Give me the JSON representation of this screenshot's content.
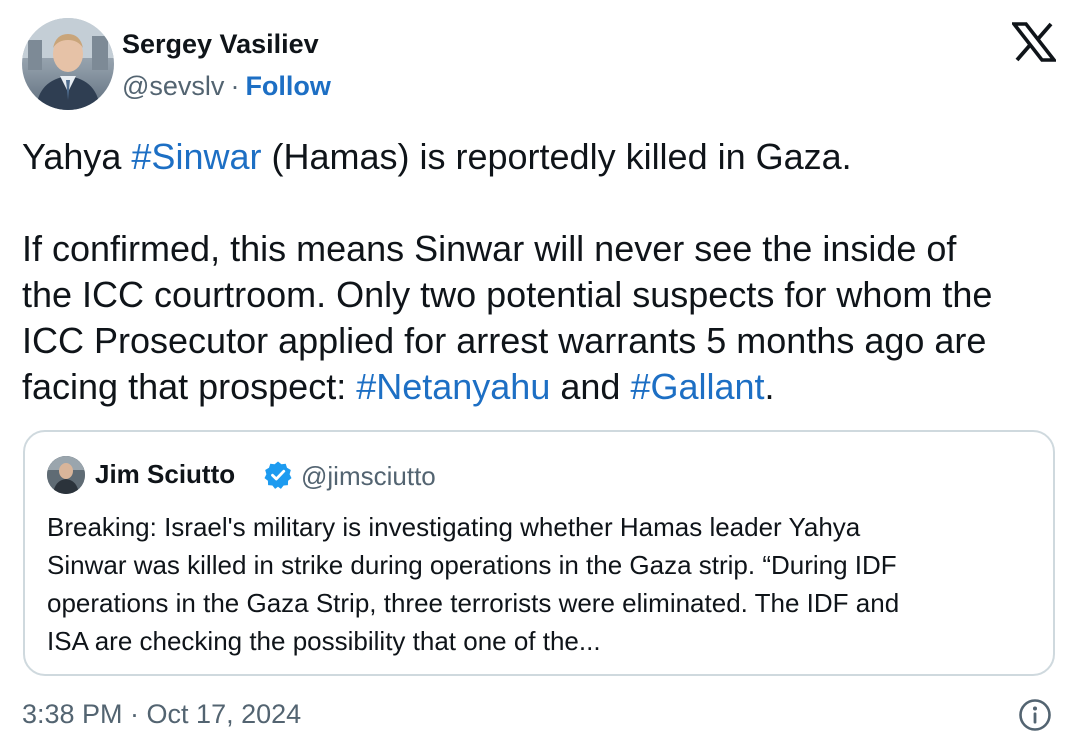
{
  "author": {
    "name": "Sergey Vasiliev",
    "handle": "@sevslv",
    "separator": "·",
    "follow_label": "Follow"
  },
  "tweet": {
    "line1": {
      "before": "Yahya ",
      "hashtag": "#Sinwar",
      "after": " (Hamas) is reportedly killed in Gaza."
    },
    "line2": "If confirmed, this means Sinwar will never see the inside of",
    "line3": "the ICC courtroom. Only two potential suspects for whom the",
    "line4": "ICC Prosecutor applied for arrest warrants 5 months ago are",
    "line5": {
      "before": "facing that prospect: ",
      "hashtag1": "#Netanyahu",
      "middle": " and ",
      "hashtag2": "#Gallant",
      "after": "."
    }
  },
  "quote": {
    "name": "Jim Sciutto",
    "handle": "@jimsciutto",
    "verified": true,
    "lines": [
      "Breaking: Israel's military is investigating whether Hamas leader Yahya",
      "Sinwar was killed  in strike during operations in the Gaza strip. “During IDF",
      "operations in the Gaza Strip, three terrorists were eliminated. The IDF and",
      "ISA are checking the possibility that one of the..."
    ]
  },
  "timestamp": "3:38 PM · Oct 17, 2024",
  "icons": {
    "brand": "x-logo-icon",
    "verified": "verified-badge-icon",
    "info": "info-icon"
  },
  "colors": {
    "link": "#1d6fc4",
    "secondary_text": "#536471",
    "primary_text": "#0f1419",
    "card_border": "#cfd9de",
    "verified": "#1d9bf0"
  }
}
